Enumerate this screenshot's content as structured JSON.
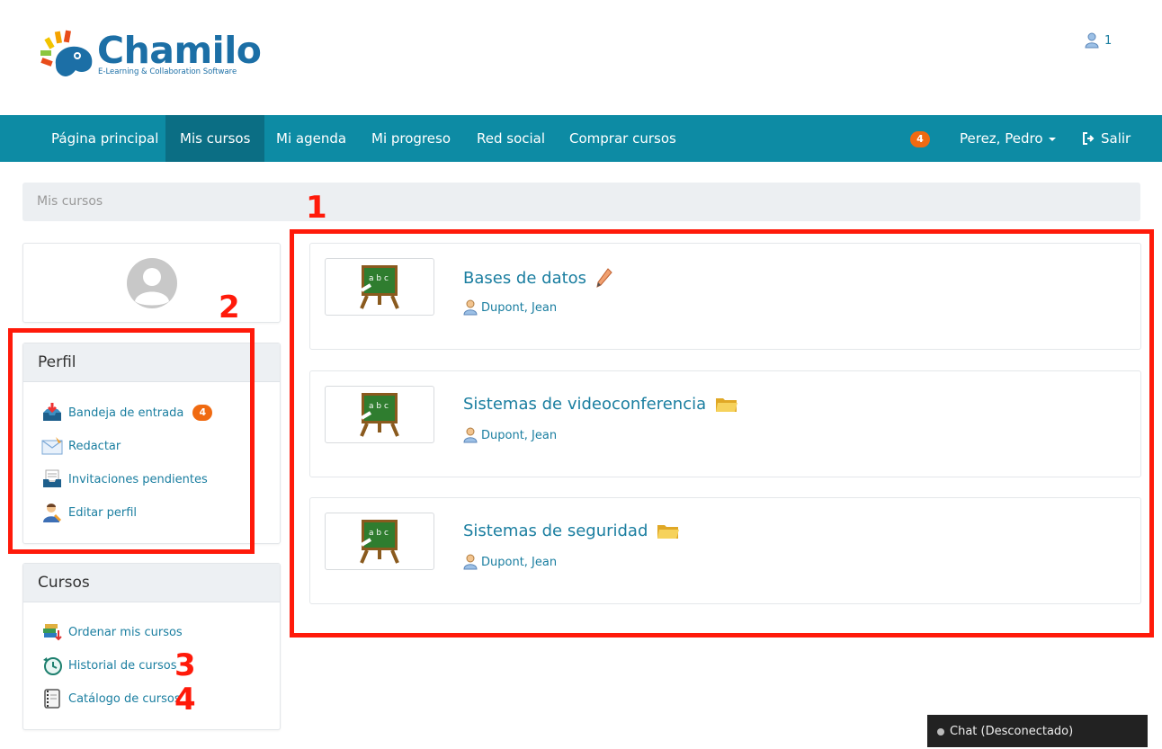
{
  "logo": {
    "name": "Chamilo",
    "tagline": "E-Learning & Collaboration Software"
  },
  "header": {
    "user_count": "1"
  },
  "nav": {
    "items": [
      "Página principal",
      "Mis cursos",
      "Mi agenda",
      "Mi progreso",
      "Red social",
      "Comprar cursos"
    ],
    "active": "Mis cursos",
    "notification_count": "4",
    "user_name": "Perez, Pedro",
    "logout": "Salir"
  },
  "breadcrumb": "Mis cursos",
  "profile_panel": {
    "title": "Perfil",
    "items": [
      {
        "label": "Bandeja de entrada",
        "icon": "inbox-icon",
        "badge": "4"
      },
      {
        "label": "Redactar",
        "icon": "compose-mail-icon"
      },
      {
        "label": "Invitaciones pendientes",
        "icon": "invitations-icon"
      },
      {
        "label": "Editar perfil",
        "icon": "edit-profile-icon"
      }
    ]
  },
  "courses_panel": {
    "title": "Cursos",
    "items": [
      {
        "label": "Ordenar mis cursos",
        "icon": "sort-courses-icon"
      },
      {
        "label": "Historial de cursos",
        "icon": "history-icon"
      },
      {
        "label": "Catálogo de cursos",
        "icon": "catalog-icon"
      }
    ]
  },
  "courses": [
    {
      "title": "Bases de datos",
      "teacher": "Dupont, Jean",
      "status_icon": "pencil-icon"
    },
    {
      "title": "Sistemas de videoconferencia",
      "teacher": "Dupont, Jean",
      "status_icon": "folder-icon"
    },
    {
      "title": "Sistemas de seguridad",
      "teacher": "Dupont, Jean",
      "status_icon": "folder-icon"
    }
  ],
  "annotations": [
    "1",
    "2",
    "3",
    "4"
  ],
  "chat": {
    "label": "Chat (Desconectado)"
  },
  "colors": {
    "nav_bg": "#0d8ba4",
    "nav_active": "#0b6e84",
    "link": "#1a7ea0",
    "badge": "#f06a11",
    "annotation": "#ff1a0a"
  }
}
